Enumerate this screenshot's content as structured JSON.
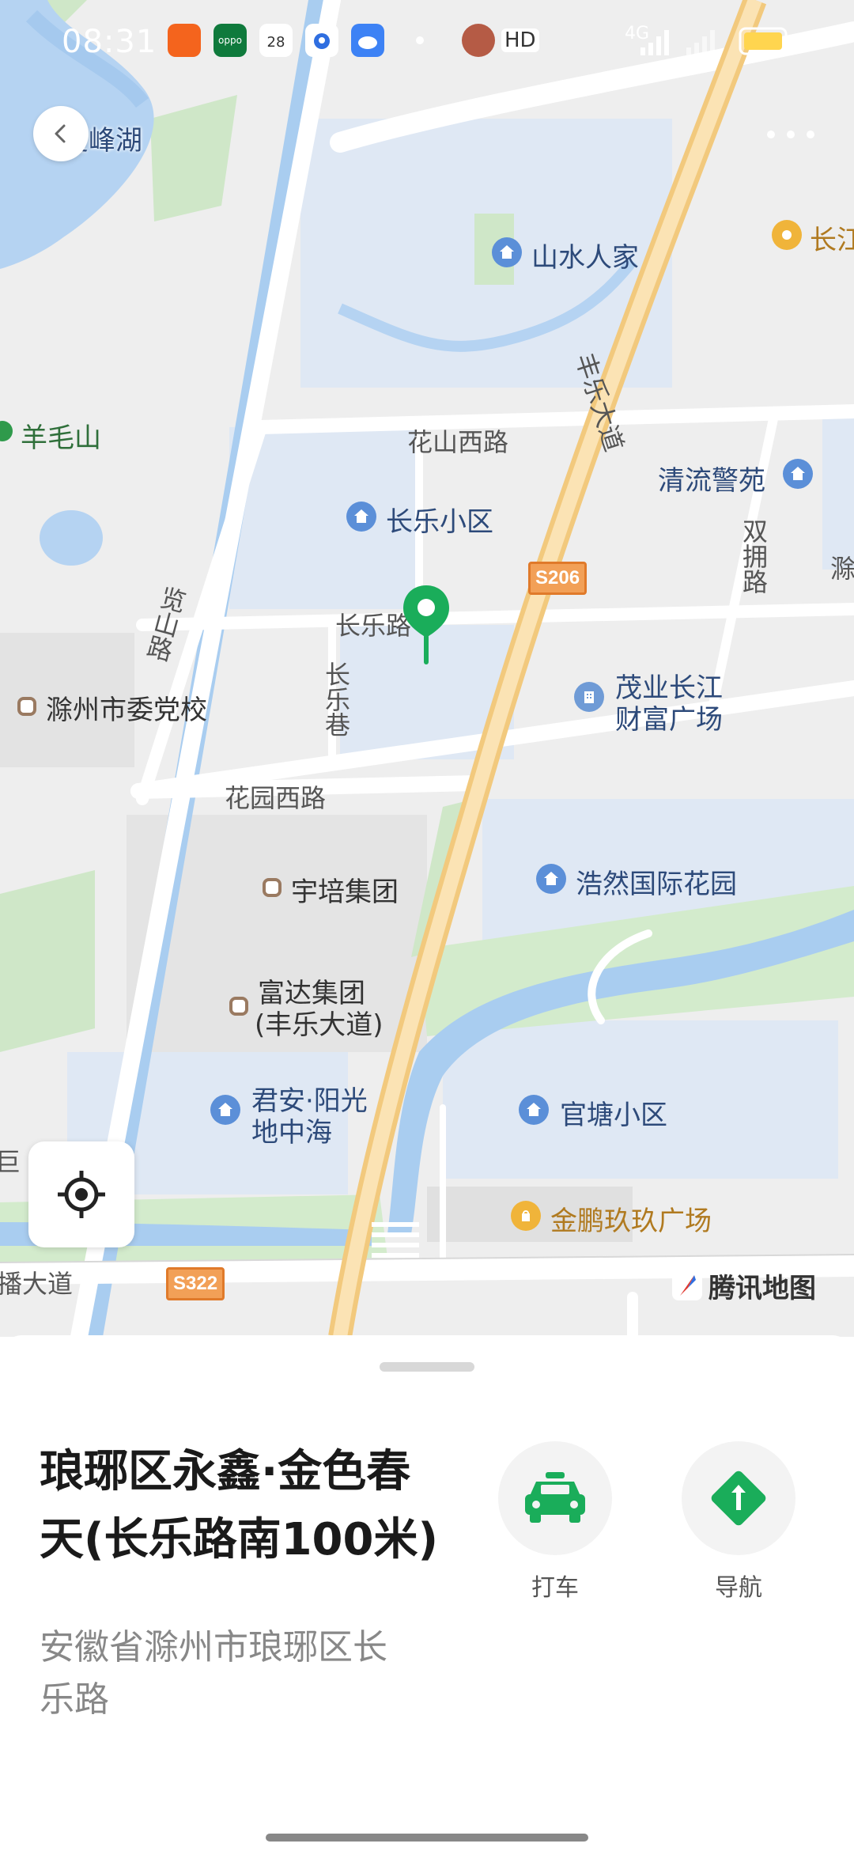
{
  "status_bar": {
    "time": "08:31",
    "app_icons": [
      "app-icon-1",
      "oppo-app-icon",
      "calendar-app-icon",
      "baidu-app-icon",
      "cloud-app-icon"
    ],
    "calendar_day": "28",
    "network_text": "4G",
    "battery_color": "#ffd54f"
  },
  "header": {
    "back_icon": "chevron-left-icon",
    "more_icon": "more-dots-icon"
  },
  "map": {
    "lake_label": "菱峰湖",
    "mountain_label": "羊毛山",
    "poi_shanshui": "山水人家",
    "poi_changjiang_right": "长江",
    "road_huashan": "花山西路",
    "road_fengle": "丰乐大道",
    "poi_qingliu": "清流警苑",
    "poi_changle_xiaoqu": "长乐小区",
    "road_shuangyong": "双拥路",
    "road_changle": "长乐路",
    "shield_s206": "S206",
    "road_lanshan": "览山路",
    "poi_dangxiao": "滁州市委党校",
    "road_changle_xiang": "长乐巷",
    "poi_maoye_line1": "茂业长江",
    "poi_maoye_line2": "财富广场",
    "road_huayuan": "花园西路",
    "poi_yupei": "宇培集团",
    "poi_haoran": "浩然国际花园",
    "poi_fuda_line1": "富达集团",
    "poi_fuda_line2": "(丰乐大道)",
    "poi_junan_line1": "君安·阳光",
    "poi_junan_line2": "地中海",
    "poi_guantang": "官塘小区",
    "poi_jinpeng": "金鹏玖玖广场",
    "road_bottom": "播大道",
    "shield_s322": "S322",
    "edge_right": "滁",
    "edge_left": "巨",
    "brand": "腾讯地图",
    "pin_color": "#1aad5a"
  },
  "controls": {
    "locate_icon": "locate-crosshair-icon"
  },
  "place": {
    "title_line1": "琅琊区永鑫·金色春",
    "title_line2": "天(长乐路南100米)",
    "address_line1": "安徽省滁州市琅琊区长",
    "address_line2": "乐路"
  },
  "actions": {
    "taxi_label": "打车",
    "taxi_icon": "taxi-icon",
    "nav_label": "导航",
    "nav_icon": "navigation-icon",
    "accent": "#1aad5a"
  }
}
